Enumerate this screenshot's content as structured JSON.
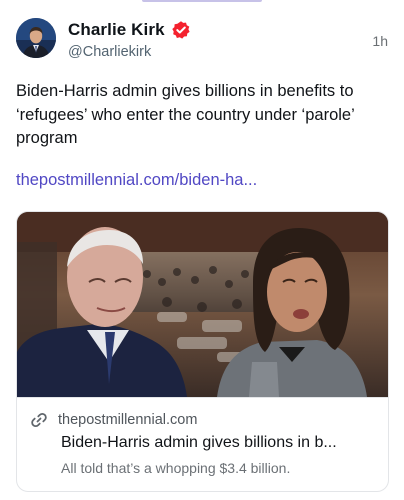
{
  "post": {
    "author": {
      "display_name": "Charlie Kirk",
      "handle": "@Charliekirk",
      "verified_icon": "verified-badge-icon",
      "verified_color": "#f4212e"
    },
    "time": "1h",
    "text": "Biden-Harris admin gives billions in benefits to ‘refugees’ who enter the country under ‘parole’ program",
    "link_text": "thepostmillennial.com/biden-ha...",
    "link_color": "#5148c4"
  },
  "card": {
    "image_icon": "news-photo",
    "domain_icon": "link-icon",
    "domain": "thepostmillennial.com",
    "title": "Biden-Harris admin gives billions in b...",
    "description": "All told that’s a whopping $3.4 billion."
  }
}
